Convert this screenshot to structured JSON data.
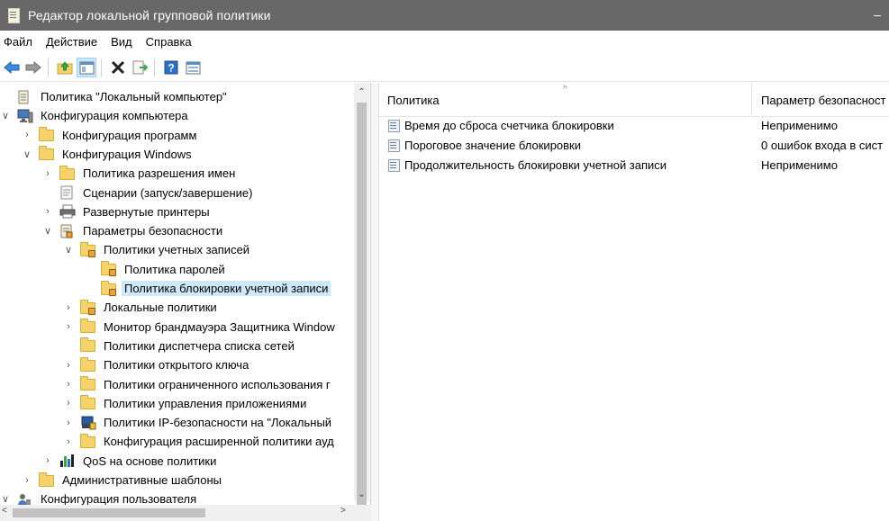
{
  "window": {
    "title": "Редактор локальной групповой политики",
    "minimize_glyph": "–"
  },
  "menu": [
    "Файл",
    "Действие",
    "Вид",
    "Справка"
  ],
  "toolbar": {
    "buttons": [
      {
        "name": "back-arrow-icon"
      },
      {
        "name": "forward-arrow-icon"
      },
      {
        "name": "up-folder-icon"
      },
      {
        "name": "show-hide-tree-icon"
      },
      {
        "name": "delete-icon"
      },
      {
        "name": "export-list-icon"
      },
      {
        "name": "help-icon"
      },
      {
        "name": "properties-icon"
      }
    ]
  },
  "tree": {
    "rows": [
      {
        "label": "Политика \"Локальный компьютер\"",
        "level": 0,
        "chev": "",
        "icon": "policy-doc-icon"
      },
      {
        "label": "Конфигурация компьютера",
        "level": 0,
        "chev": "∨",
        "icon": "computer-icon"
      },
      {
        "label": "Конфигурация программ",
        "level": 1,
        "chev": "›",
        "icon": "folder-icon"
      },
      {
        "label": "Конфигурация Windows",
        "level": 1,
        "chev": "∨",
        "icon": "folder-icon"
      },
      {
        "label": "Политика разрешения имен",
        "level": 2,
        "chev": "›",
        "icon": "folder-icon"
      },
      {
        "label": "Сценарии (запуск/завершение)",
        "level": 2,
        "chev": "",
        "icon": "script-icon"
      },
      {
        "label": "Развернутые принтеры",
        "level": 2,
        "chev": "›",
        "icon": "printer-icon"
      },
      {
        "label": "Параметры безопасности",
        "level": 2,
        "chev": "∨",
        "icon": "security-settings-icon"
      },
      {
        "label": "Политики учетных записей",
        "level": 3,
        "chev": "∨",
        "icon": "locked-folder-icon"
      },
      {
        "label": "Политика паролей",
        "level": 4,
        "chev": "",
        "icon": "locked-folder-icon"
      },
      {
        "label": "Политика блокировки учетной записи",
        "level": 4,
        "chev": "",
        "icon": "locked-folder-icon",
        "selected": true
      },
      {
        "label": "Локальные политики",
        "level": 3,
        "chev": "›",
        "icon": "locked-folder-icon"
      },
      {
        "label": "Монитор брандмауэра Защитника Window",
        "level": 3,
        "chev": "›",
        "icon": "folder-icon"
      },
      {
        "label": "Политики диспетчера списка сетей",
        "level": 3,
        "chev": "",
        "icon": "folder-icon"
      },
      {
        "label": "Политики открытого ключа",
        "level": 3,
        "chev": "›",
        "icon": "folder-icon"
      },
      {
        "label": "Политики ограниченного использования г",
        "level": 3,
        "chev": "›",
        "icon": "folder-icon"
      },
      {
        "label": "Политики управления приложениями",
        "level": 3,
        "chev": "›",
        "icon": "folder-icon"
      },
      {
        "label": "Политики IP-безопасности на \"Локальный",
        "level": 3,
        "chev": "›",
        "icon": "ipsec-icon"
      },
      {
        "label": "Конфигурация расширенной политики ауд",
        "level": 3,
        "chev": "›",
        "icon": "folder-icon"
      },
      {
        "label": "QoS на основе политики",
        "level": 2,
        "chev": "›",
        "icon": "chart-bars-icon"
      },
      {
        "label": "Административные шаблоны",
        "level": 1,
        "chev": "›",
        "icon": "folder-icon"
      },
      {
        "label": "Конфигурация пользователя",
        "level": 0,
        "chev": "∨",
        "icon": "user-icon"
      }
    ]
  },
  "scrollbars": {
    "up": "⌃",
    "down": "⌄",
    "left": "<",
    "right": ">"
  },
  "list": {
    "columns": [
      "Политика",
      "Параметр безопасност"
    ],
    "sort_glyph": "^",
    "rows": [
      {
        "policy": "Время до сброса счетчика блокировки",
        "setting": "Неприменимо"
      },
      {
        "policy": "Пороговое значение блокировки",
        "setting": "0 ошибок входа в сист"
      },
      {
        "policy": "Продолжительность блокировки учетной записи",
        "setting": "Неприменимо"
      }
    ]
  },
  "colors": {
    "titlebar": "#686868",
    "selection": "#cde8f7",
    "folder": "#f5d26a"
  }
}
